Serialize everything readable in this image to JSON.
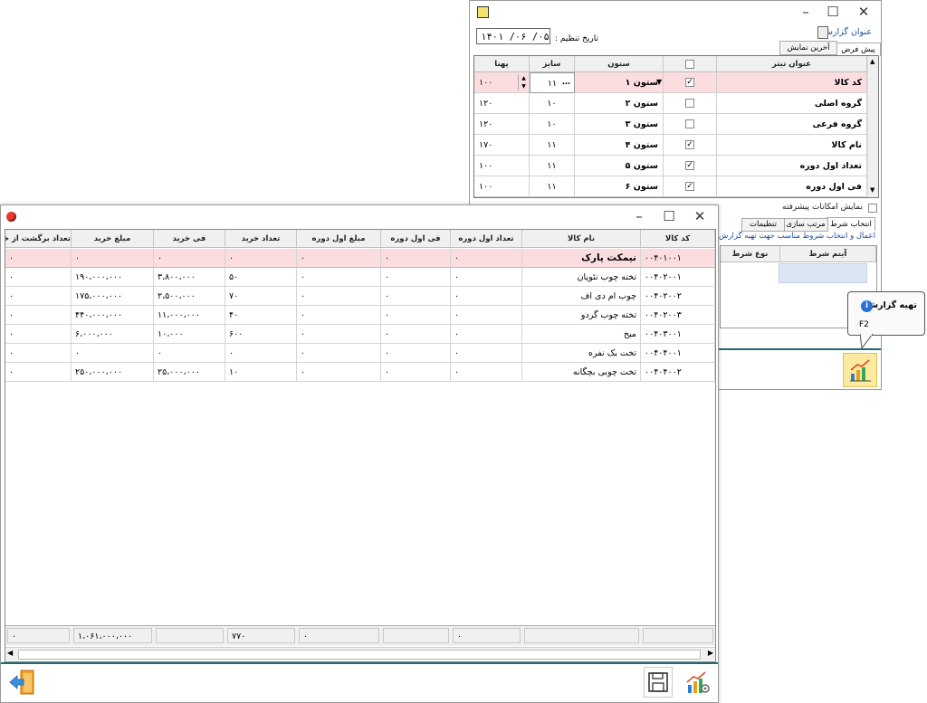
{
  "settings": {
    "report_title_label": "عنوان گزارش :",
    "date_label": "تاریخ تنظیم :",
    "date_value": "۱۴۰۱ /۰۶ /۰۵",
    "tabs": [
      "پیش فرض",
      "آخرین نمایش"
    ],
    "col_headers": {
      "caption": "عنوان تیتر",
      "column": "ستون",
      "size": "سایز",
      "width": "پهنا"
    },
    "rows": [
      {
        "caption": "کد کالا",
        "checked": true,
        "column": "ستون ۱",
        "size": "۱۱",
        "width": "۱۰۰"
      },
      {
        "caption": "گروه اصلی",
        "checked": false,
        "column": "ستون ۲",
        "size": "۱۰",
        "width": "۱۲۰"
      },
      {
        "caption": "گروه فرعی",
        "checked": false,
        "column": "ستون ۳",
        "size": "۱۰",
        "width": "۱۲۰"
      },
      {
        "caption": "نام کالا",
        "checked": true,
        "column": "ستون ۴",
        "size": "۱۱",
        "width": "۱۷۰"
      },
      {
        "caption": "تعداد اول دوره",
        "checked": true,
        "column": "ستون ۵",
        "size": "۱۱",
        "width": "۱۰۰"
      },
      {
        "caption": "فی اول دوره",
        "checked": true,
        "column": "ستون ۶",
        "size": "۱۱",
        "width": "۱۰۰"
      }
    ],
    "advanced_label": "نمایش امکانات پیشرفته",
    "lower_tabs": [
      "انتخاب شرط",
      "مرتب سازی",
      "تنظیمات"
    ],
    "condition_hint": "اعمال و انتخاب شروط مناسب جهت تهیه گزارش",
    "cond_headers": {
      "item": "آیتم شرط",
      "type": "نوع شرط"
    }
  },
  "tooltip": {
    "title": "تهیه گزارش",
    "shortcut": "F2"
  },
  "report": {
    "headers": [
      "کد کالا",
      "نام کالا",
      "تعداد اول دوره",
      "فی اول دوره",
      "مبلغ اول دوره",
      "تعداد خرید",
      "فی خرید",
      "مبلغ خرید",
      "تعداد برگشت از خر"
    ],
    "group_row": {
      "code": "۰۰۴۰۱۰۰۱",
      "name": "نیمکت پارک",
      "vals": [
        "۰",
        "۰",
        "۰",
        "۰",
        "۰",
        "۰",
        "۰"
      ]
    },
    "rows": [
      {
        "code": "۰۰۴۰۲۰۰۱",
        "name": "تخته چوب نئوپان",
        "vals": [
          "۰",
          "۰",
          "۰",
          "۵۰",
          "۳،۸۰۰،۰۰۰",
          "۱۹۰،۰۰۰،۰۰۰",
          "۰"
        ]
      },
      {
        "code": "۰۰۴۰۲۰۰۲",
        "name": "چوب ام دی اف",
        "vals": [
          "۰",
          "۰",
          "۰",
          "۷۰",
          "۲،۵۰۰،۰۰۰",
          "۱۷۵،۰۰۰،۰۰۰",
          "۰"
        ]
      },
      {
        "code": "۰۰۴۰۲۰۰۳",
        "name": "تخته چوب گردو",
        "vals": [
          "۰",
          "۰",
          "۰",
          "۴۰",
          "۱۱،۰۰۰،۰۰۰",
          "۴۴۰،۰۰۰،۰۰۰",
          "۰"
        ]
      },
      {
        "code": "۰۰۴۰۳۰۰۱",
        "name": "میخ",
        "vals": [
          "۰",
          "۰",
          "۰",
          "۶۰۰",
          "۱۰،۰۰۰",
          "۶،۰۰۰،۰۰۰",
          "۰"
        ]
      },
      {
        "code": "۰۰۴۰۴۰۰۱",
        "name": "تخت یک نفره",
        "vals": [
          "۰",
          "۰",
          "۰",
          "۰",
          "۰",
          "۰",
          "۰"
        ]
      },
      {
        "code": "۰۰۴۰۴۰۰۲",
        "name": "تخت چوبی بچگانه",
        "vals": [
          "۰",
          "۰",
          "۰",
          "۱۰",
          "۲۵،۰۰۰،۰۰۰",
          "۲۵۰،۰۰۰،۰۰۰",
          "۰"
        ]
      }
    ],
    "totals": {
      "opening_qty": "۰",
      "opening_amount": "۰",
      "purchase_qty": "۷۷۰",
      "purchase_amount": "۱،۰۶۱،۰۰۰،۰۰۰",
      "return_qty": "۰"
    }
  }
}
